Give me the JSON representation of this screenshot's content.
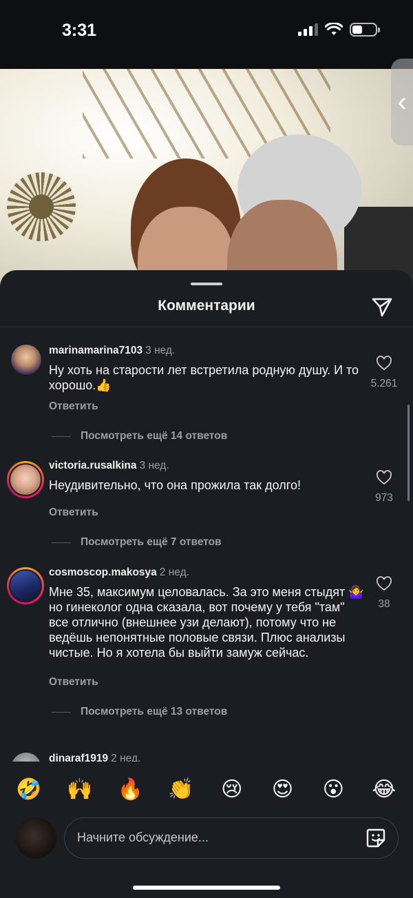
{
  "status_bar": {
    "time": "3:31"
  },
  "sheet": {
    "title": "Комментарии"
  },
  "comments": [
    {
      "username": "marinamarina7103",
      "time": "3 нед.",
      "text": "Ну хоть на старости лет встретила родную душу. И то хорошо.👍",
      "likes": "5.261",
      "reply_label": "Ответить",
      "more_replies": "Посмотреть ещё 14 ответов",
      "avatar_color": "#8b7a9b"
    },
    {
      "username": "victoria.rusalkina",
      "time": "3 нед.",
      "text": "Неудивительно, что она прожила так долго!",
      "likes": "973",
      "reply_label": "Ответить",
      "more_replies": "Посмотреть ещё 7 ответов",
      "avatar_color": "#d9b49a"
    },
    {
      "username": "cosmoscop.makosya",
      "time": "2 нед.",
      "text": "Мне 35, максимум целовалась. За это меня стыдят 🤷‍♀️ но гинеколог одна сказала, вот почему у тебя \"там\" все отлично (внешнее узи делают), потому что не ведёшь непонятные половые связи. Плюс анализы чистые. Но я хотела бы выйти замуж сейчас.",
      "likes": "38",
      "reply_label": "Ответить",
      "more_replies": "Посмотреть ещё 13 ответов",
      "avatar_color": "#2a3a7a"
    },
    {
      "username": "dinaraf1919",
      "time": "2 нед.",
      "avatar_color": "#8a8a8a"
    }
  ],
  "emoji_bar": [
    "🤣",
    "🙌",
    "🔥",
    "👏",
    "😢",
    "😍",
    "😮",
    "😂"
  ],
  "input": {
    "placeholder": "Начните обсуждение..."
  },
  "colors": {
    "sheet_bg": "#1a1d22",
    "muted_text": "#9aa0a6"
  }
}
